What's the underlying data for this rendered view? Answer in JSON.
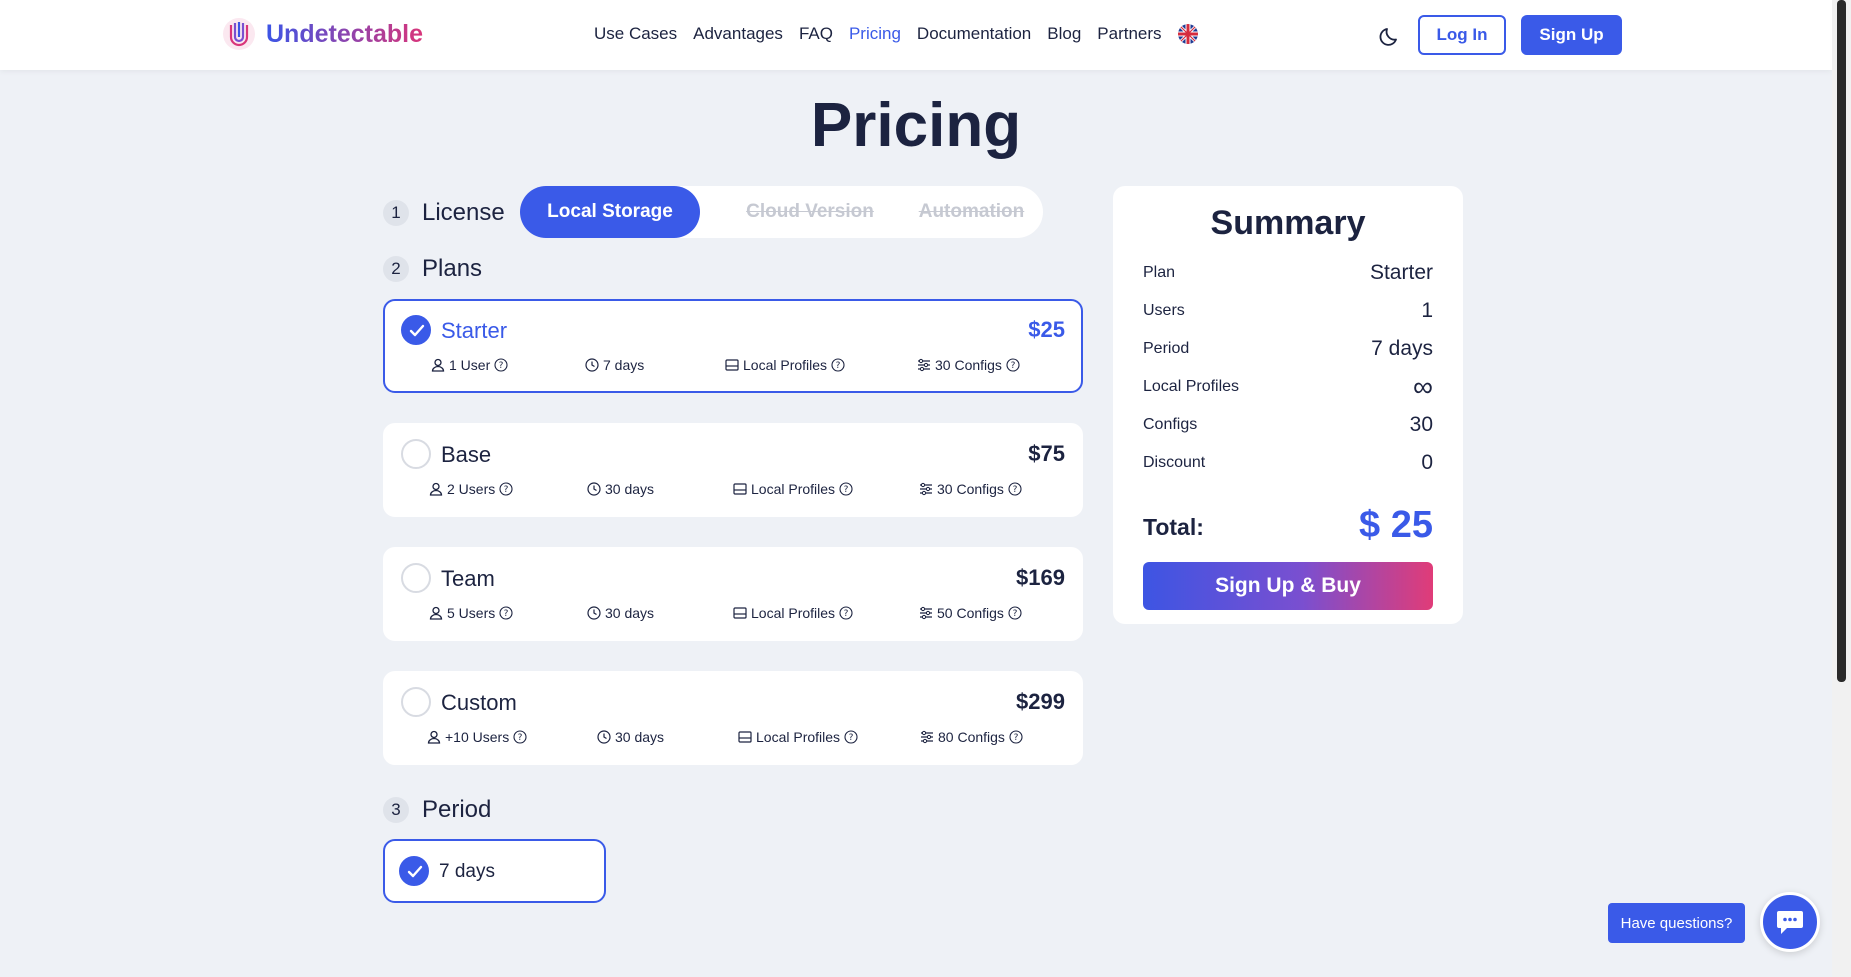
{
  "header": {
    "logo_text": "Undetectable",
    "nav": [
      "Use Cases",
      "Advantages",
      "FAQ",
      "Pricing",
      "Documentation",
      "Blog",
      "Partners"
    ],
    "active_nav": "Pricing",
    "login_label": "Log In",
    "signup_label": "Sign Up"
  },
  "page_title": "Pricing",
  "steps": {
    "license": {
      "num": "1",
      "label": "License"
    },
    "plans": {
      "num": "2",
      "label": "Plans"
    },
    "period": {
      "num": "3",
      "label": "Period"
    }
  },
  "license_tabs": {
    "active": "Local Storage",
    "cloud": "Cloud Version",
    "automation": "Automation"
  },
  "plans": [
    {
      "name": "Starter",
      "price": "$25",
      "users": "1 User",
      "days": "7 days",
      "profiles": "Local Profiles",
      "configs": "30 Configs",
      "selected": true
    },
    {
      "name": "Base",
      "price": "$75",
      "users": "2 Users",
      "days": "30 days",
      "profiles": "Local Profiles",
      "configs": "30 Configs",
      "selected": false
    },
    {
      "name": "Team",
      "price": "$169",
      "users": "5 Users",
      "days": "30 days",
      "profiles": "Local Profiles",
      "configs": "50 Configs",
      "selected": false
    },
    {
      "name": "Custom",
      "price": "$299",
      "users": "+10 Users",
      "days": "30 days",
      "profiles": "Local Profiles",
      "configs": "80 Configs",
      "selected": false
    }
  ],
  "period": {
    "label": "7 days",
    "selected": true
  },
  "summary": {
    "title": "Summary",
    "rows": [
      {
        "key": "Plan",
        "value": "Starter"
      },
      {
        "key": "Users",
        "value": "1"
      },
      {
        "key": "Period",
        "value": "7 days"
      },
      {
        "key": "Local Profiles",
        "value": "∞"
      },
      {
        "key": "Configs",
        "value": "30"
      },
      {
        "key": "Discount",
        "value": "0"
      }
    ],
    "total_label": "Total:",
    "total_value": "$ 25",
    "buy_label": "Sign Up & Buy"
  },
  "help": {
    "label": "Have questions?"
  },
  "colors": {
    "accent": "#3a5ae8",
    "background": "#eef1f6",
    "text": "#1c2340"
  }
}
